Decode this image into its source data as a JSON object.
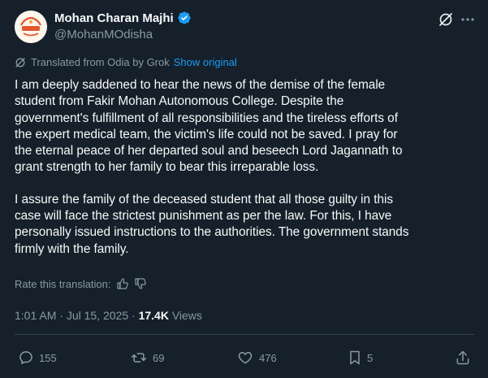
{
  "author": {
    "name": "Mohan Charan Majhi",
    "handle": "@MohanMOdisha"
  },
  "translation": {
    "note": "Translated from Odia by Grok",
    "show_original": "Show original"
  },
  "body": {
    "p1": "I am deeply saddened to hear the news of the demise of the female\nstudent from Fakir Mohan Autonomous College. Despite the\ngovernment's fulfillment of all responsibilities and the tireless efforts of\nthe expert medical team, the victim's life could not be saved. I pray for\nthe eternal peace of her departed soul and beseech Lord Jagannath to\ngrant strength to her family to bear this irreparable loss.",
    "p2": "I assure the family of the deceased student that all those guilty in this\ncase will face the strictest punishment as per the law. For this, I have\npersonally issued instructions to the authorities. The government stands\nfirmly with the family."
  },
  "rate": {
    "label": "Rate this translation:"
  },
  "meta": {
    "time": "1:01 AM",
    "sep1": " · ",
    "date": "Jul 15, 2025",
    "sep2": " · ",
    "views_count": "17.4K",
    "views_label": " Views"
  },
  "actions": {
    "replies": "155",
    "reposts": "69",
    "likes": "476",
    "bookmarks": "5"
  },
  "colors": {
    "background": "#15202b",
    "text": "#f7f9f9",
    "secondary": "#8b98a5",
    "link": "#1d9bf0",
    "verified": "#1d9bf0",
    "divider": "#38444d"
  },
  "icons": [
    "verified-badge-icon",
    "grok-icon",
    "more-icon",
    "translate-icon",
    "thumbs-up-icon",
    "thumbs-down-icon",
    "reply-icon",
    "repost-icon",
    "like-icon",
    "bookmark-icon",
    "share-icon"
  ]
}
